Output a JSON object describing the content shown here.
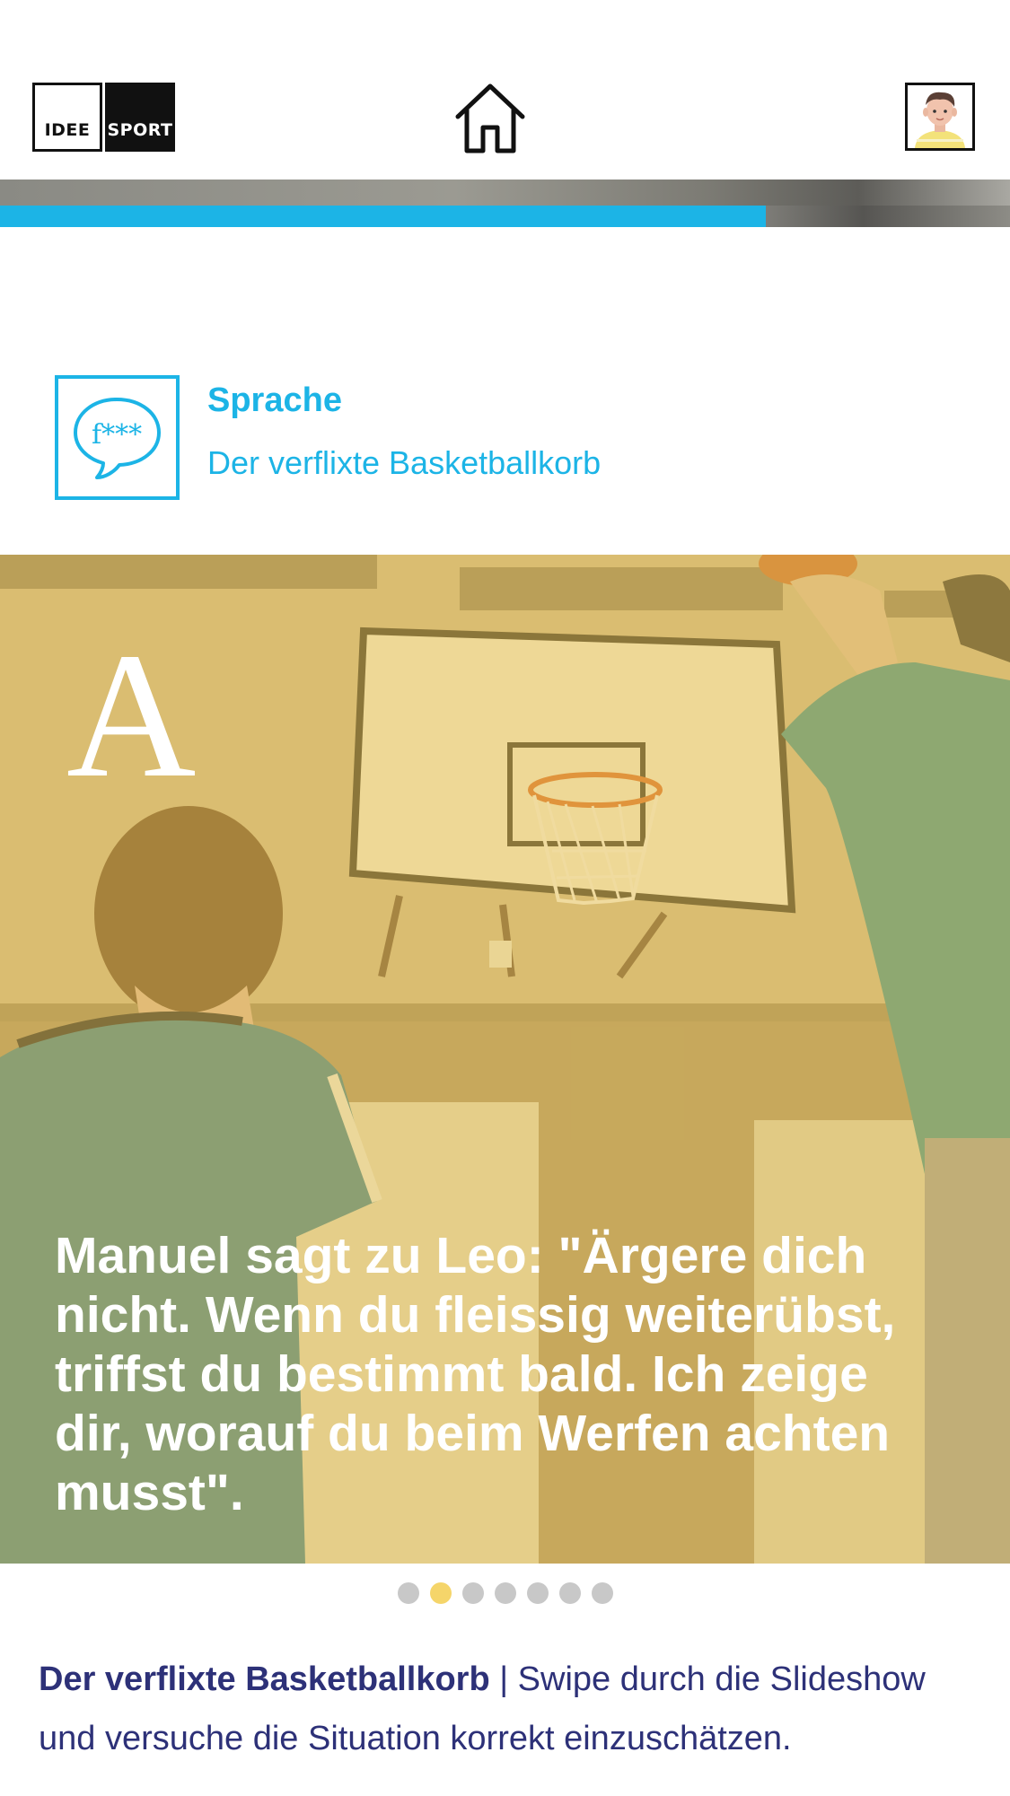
{
  "header": {
    "logo_left": "IDEE",
    "logo_right": "SPORT"
  },
  "progress": {
    "fraction": 0.758,
    "color": "#1cb4e6"
  },
  "category": {
    "icon_text": "f***",
    "title": "Sprache",
    "subtitle": "Der verflixte Basketballkorb",
    "accent_color": "#1cb4e6"
  },
  "slide": {
    "letter": "A",
    "text": "Manuel sagt zu Leo: \"Ärgere dich nicht. Wenn du fleissig weiterübst, triffst du bestimmt bald. Ich zeige dir, worauf du beim Werfen achten musst\".",
    "overlay_color": "#f0c850"
  },
  "pagination": {
    "count": 7,
    "active_index": 1,
    "active_color": "#f5d56a"
  },
  "caption": {
    "title": "Der verflixte Basketballkorb",
    "separator": "|",
    "text": "Swipe durch die Slideshow und versuche die Situation korrekt einzuschätzen.",
    "color": "#2d3178"
  }
}
